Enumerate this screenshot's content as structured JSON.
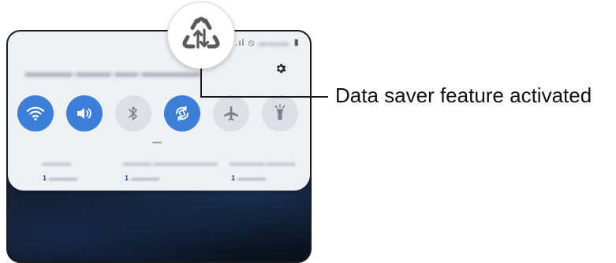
{
  "callout": {
    "label": "Data saver feature activated",
    "icon": "data-saver-icon"
  },
  "status_bar": {
    "icons": [
      "signal-icon",
      "no-sim-icon",
      "battery-icon"
    ]
  },
  "quick_panel": {
    "gear_icon": "settings-gear-icon",
    "tiles": [
      {
        "icon": "wifi-icon",
        "state": "on"
      },
      {
        "icon": "sound-icon",
        "state": "on"
      },
      {
        "icon": "bluetooth-icon",
        "state": "off"
      },
      {
        "icon": "auto-rotate-icon",
        "state": "on"
      },
      {
        "icon": "airplane-mode-icon",
        "state": "off"
      },
      {
        "icon": "flashlight-icon",
        "state": "off"
      }
    ],
    "sim_columns": [
      {
        "sim_label": "1"
      },
      {
        "sim_label": "1"
      },
      {
        "sim_label": "1"
      }
    ]
  },
  "colors": {
    "tile_on": "#3d7fd6",
    "tile_off": "#dcdfe5",
    "panel_bg": "#eef0f4",
    "sim_badge": "#1d3f8f"
  }
}
